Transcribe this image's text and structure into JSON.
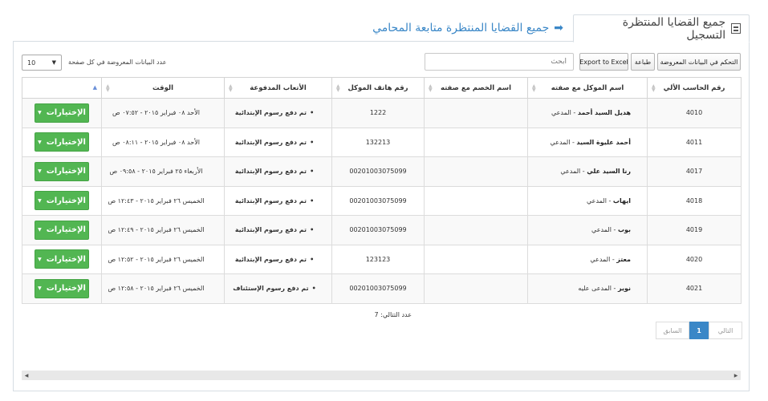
{
  "tabs": {
    "active_label": "جميع القضايا المنتظرة التسجيل",
    "link_label": "جميع القضايا المنتظرة متابعة المحامي"
  },
  "toolbar": {
    "column_control_label": "التحكم في البيانات المعروضة",
    "print_label": "طباعة",
    "export_label": "Export to Excel",
    "search_placeholder": "ابحث",
    "page_size_value": "10",
    "page_size_label": "عدد البيانات المعروضة في كل صفحة"
  },
  "table": {
    "columns": [
      "رقم الحاسب الألي",
      "اسم الموكل مع صفته",
      "اسم الخصم مع صفته",
      "رقم هاتف الموكل",
      "الأتعاب المدفوعة",
      "الوقت",
      ""
    ],
    "options_label": "الإختيارات",
    "rows": [
      {
        "id": "4010",
        "client": "هديل السيد أحمد",
        "role": " - المدعي",
        "opponent": "",
        "phone": "1222",
        "paid": "تم دفع رسوم الإبتدائية",
        "time": "الأحد ٠٨ فبراير ٢٠١٥ - ٠٧:٥٢ ص"
      },
      {
        "id": "4011",
        "client": "أحمد عليوة السيد",
        "role": " - المدعي",
        "opponent": "",
        "phone": "132213",
        "paid": "تم دفع رسوم الإبتدائية",
        "time": "الأحد ٠٨ فبراير ٢٠١٥ - ٠٨:١١ ص"
      },
      {
        "id": "4017",
        "client": "رنا السيد علي",
        "role": " - المدعي",
        "opponent": "",
        "phone": "00201003075099",
        "paid": "تم دفع رسوم الإبتدائية",
        "time": "الأربعاء ٢٥ فبراير ٢٠١٥ - ٠٩:٥٨ ص"
      },
      {
        "id": "4018",
        "client": "ايهاب",
        "role": " - المدعي",
        "opponent": "",
        "phone": "00201003075099",
        "paid": "تم دفع رسوم الإبتدائية",
        "time": "الخميس ٢٦ فبراير ٢٠١٥ - ١٢:٤٣ ص"
      },
      {
        "id": "4019",
        "client": "بوب",
        "role": " - المدعي",
        "opponent": "",
        "phone": "00201003075099",
        "paid": "تم دفع رسوم الإبتدائية",
        "time": "الخميس ٢٦ فبراير ٢٠١٥ - ١٢:٤٩ ص"
      },
      {
        "id": "4020",
        "client": "معتز",
        "role": " - المدعي",
        "opponent": "",
        "phone": "123123",
        "paid": "تم دفع رسوم الإبتدائية",
        "time": "الخميس ٢٦ فبراير ٢٠١٥ - ١٢:٥٢ ص"
      },
      {
        "id": "4021",
        "client": "نوير",
        "role": " - المدعى عليه",
        "opponent": "",
        "phone": "00201003075099",
        "paid": "تم دفع رسوم الإستئناف",
        "time": "الخميس ٢٦ فبراير ٢٠١٥ - ١٢:٥٨ ص"
      }
    ]
  },
  "footer": {
    "count_text": "عدد التتالي: 7",
    "pager": {
      "next": "التالي",
      "current": "1",
      "prev": "السابق"
    }
  }
}
